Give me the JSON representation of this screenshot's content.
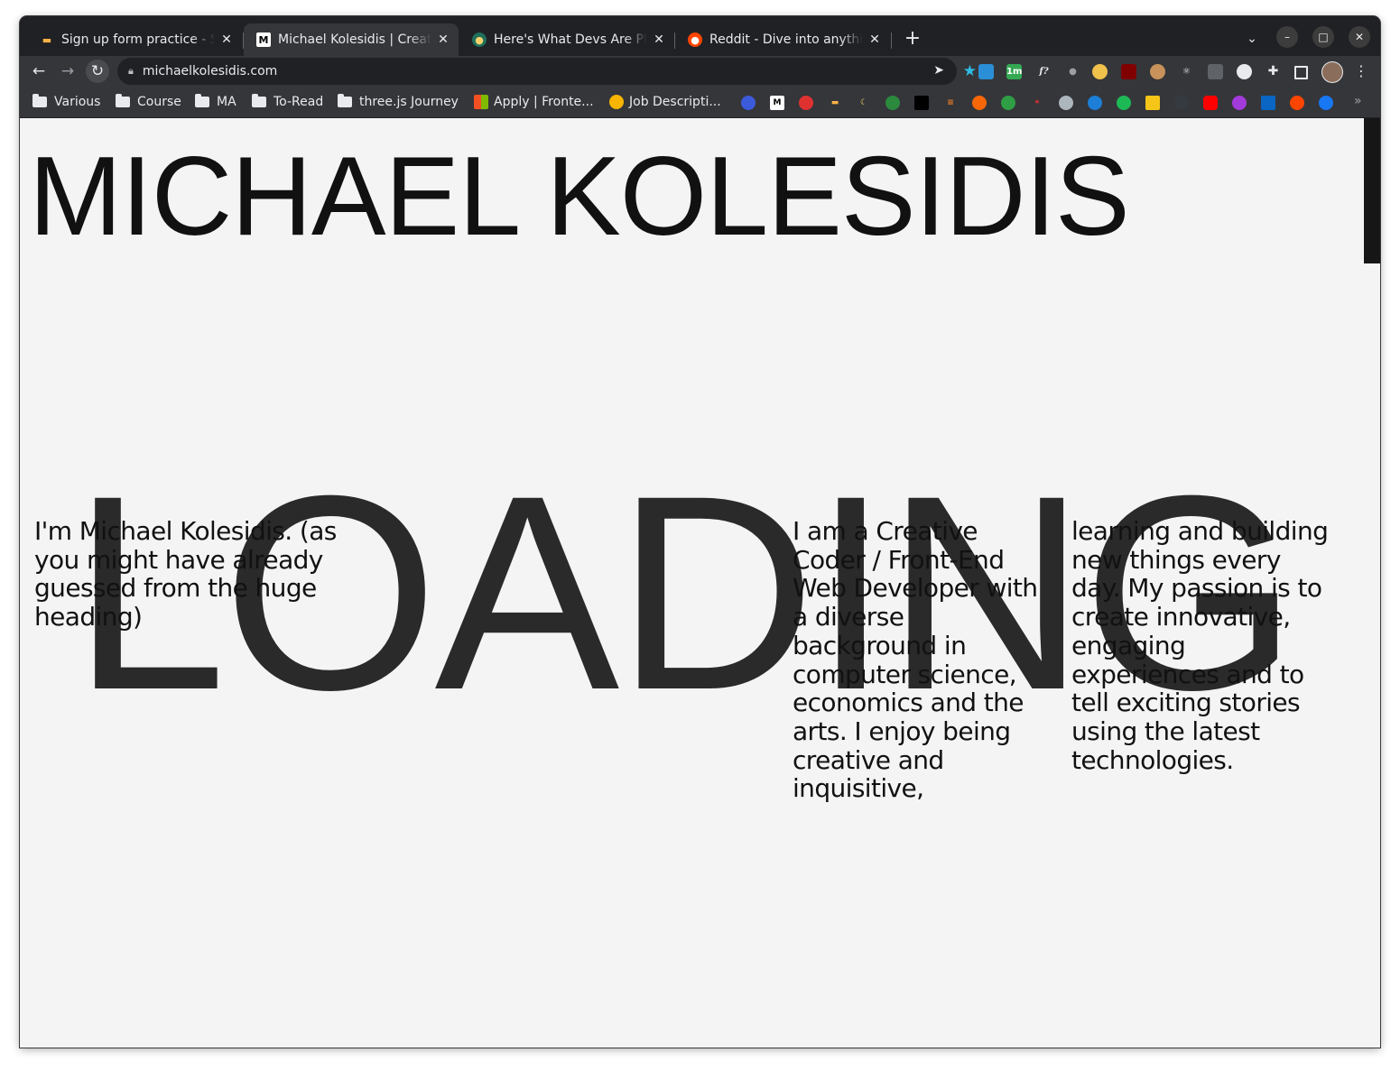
{
  "browser": {
    "tabs": [
      {
        "title": "Sign up form practice - Scrimba",
        "favicon": "scrimba-icon",
        "active": false
      },
      {
        "title": "Michael Kolesidis | Creative Coder",
        "favicon": "m-logo-icon",
        "active": true
      },
      {
        "title": "Here's What Devs Are Planning",
        "favicon": "devs-icon",
        "active": false
      },
      {
        "title": "Reddit - Dive into anything",
        "favicon": "reddit-icon",
        "active": false
      }
    ],
    "new_tab_label": "+",
    "tab_search_label": "⌄",
    "address": "michaelkolesidis.com",
    "bookmarks": [
      {
        "label": "Various",
        "type": "folder"
      },
      {
        "label": "Course",
        "type": "folder"
      },
      {
        "label": "MA",
        "type": "folder"
      },
      {
        "label": "To-Read",
        "type": "folder"
      },
      {
        "label": "three.js Journey",
        "type": "folder"
      },
      {
        "label": "Apply | Fronte...",
        "type": "link"
      },
      {
        "label": "Job Descripti...",
        "type": "link"
      }
    ],
    "extension_badge": "1m",
    "colors": {
      "frame": "#202124",
      "toolbar": "#35363a",
      "star": "#2dbde6"
    }
  },
  "page": {
    "hero_title": "MICHAEL KOLESIDIS",
    "loading_text": "LOADING",
    "intro": "I'm Michael Kolesidis. (as you might have already guessed from the huge heading)",
    "about_1": "I am a Creative Coder / Front-End Web Developer with a diverse background in computer science, economics and the arts. I enjoy being creative and inquisitive,",
    "about_2": "learning and building new things every day. My passion is to create innovative, engaging experiences and to tell exciting stories using the latest technologies.",
    "background_color": "#f4f4f4"
  }
}
